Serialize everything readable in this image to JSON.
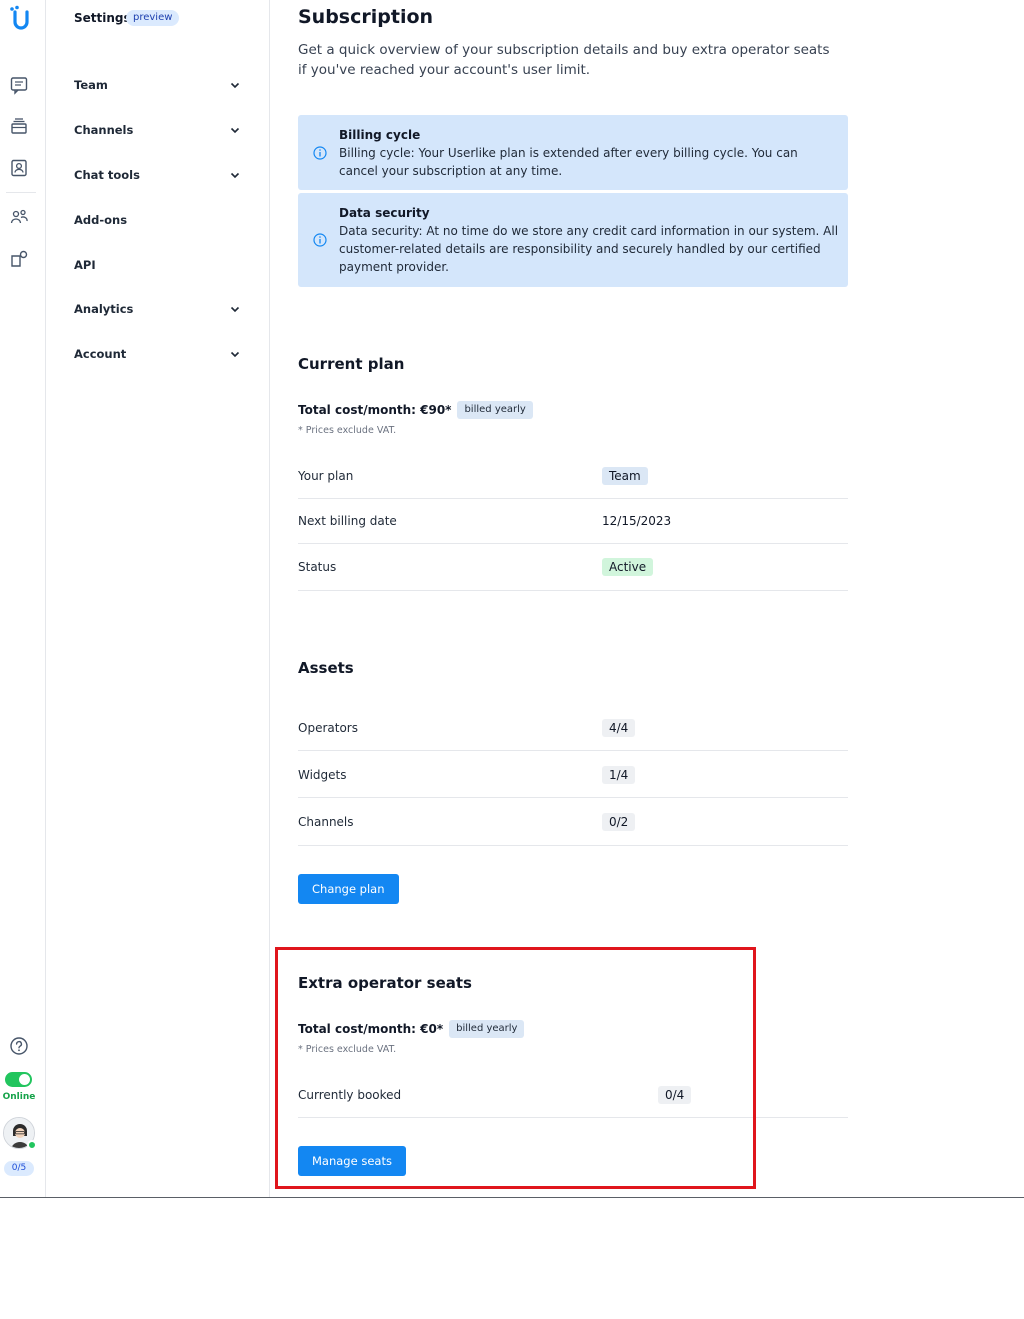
{
  "nav": {
    "title": "Settings",
    "preview": "preview",
    "items": [
      {
        "label": "Team",
        "has_children": true
      },
      {
        "label": "Channels",
        "has_children": true
      },
      {
        "label": "Chat tools",
        "has_children": true
      },
      {
        "label": "Add-ons",
        "has_children": false
      },
      {
        "label": "API",
        "has_children": false
      },
      {
        "label": "Analytics",
        "has_children": true
      },
      {
        "label": "Account",
        "has_children": true
      }
    ]
  },
  "rail": {
    "icons": [
      "userlike-logo-icon",
      "chat-icon",
      "inbox-stack-icon",
      "contacts-icon",
      "team-icon",
      "integrations-icon",
      "help-icon"
    ],
    "status": "Online",
    "seats": "0/5",
    "accent": "#1387f2",
    "online_color": "#22c55e"
  },
  "page": {
    "title": "Subscription",
    "subtitle": "Get a quick overview of your subscription details and buy extra operator seats if you've reached your account's user limit."
  },
  "info": [
    {
      "title": "Billing cycle",
      "text": "Billing cycle: Your Userlike plan is extended after every billing cycle. You can cancel your subscription at any time."
    },
    {
      "title": "Data security",
      "text": "Data security: At no time do we store any credit card information in our system. All customer-related details are responsibility and securely handled by our certified payment provider."
    }
  ],
  "current_plan": {
    "title": "Current plan",
    "cost": "Total cost/month: €90*",
    "billed": "billed yearly",
    "vat": "* Prices exclude VAT.",
    "rows": [
      {
        "label": "Your plan",
        "value": "Team"
      },
      {
        "label": "Next billing date",
        "value": "12/15/2023"
      },
      {
        "label": "Status",
        "value": "Active"
      }
    ]
  },
  "assets": {
    "title": "Assets",
    "rows": [
      {
        "label": "Operators",
        "value": "4/4"
      },
      {
        "label": "Widgets",
        "value": "1/4"
      },
      {
        "label": "Channels",
        "value": "0/2"
      }
    ],
    "button": "Change plan"
  },
  "extra_seats": {
    "title": "Extra operator seats",
    "cost": "Total cost/month: €0*",
    "billed": "billed yearly",
    "vat": "* Prices exclude VAT.",
    "row": {
      "label": "Currently booked",
      "value": "0/4"
    },
    "button": "Manage seats",
    "highlight_color": "#e0151c"
  }
}
